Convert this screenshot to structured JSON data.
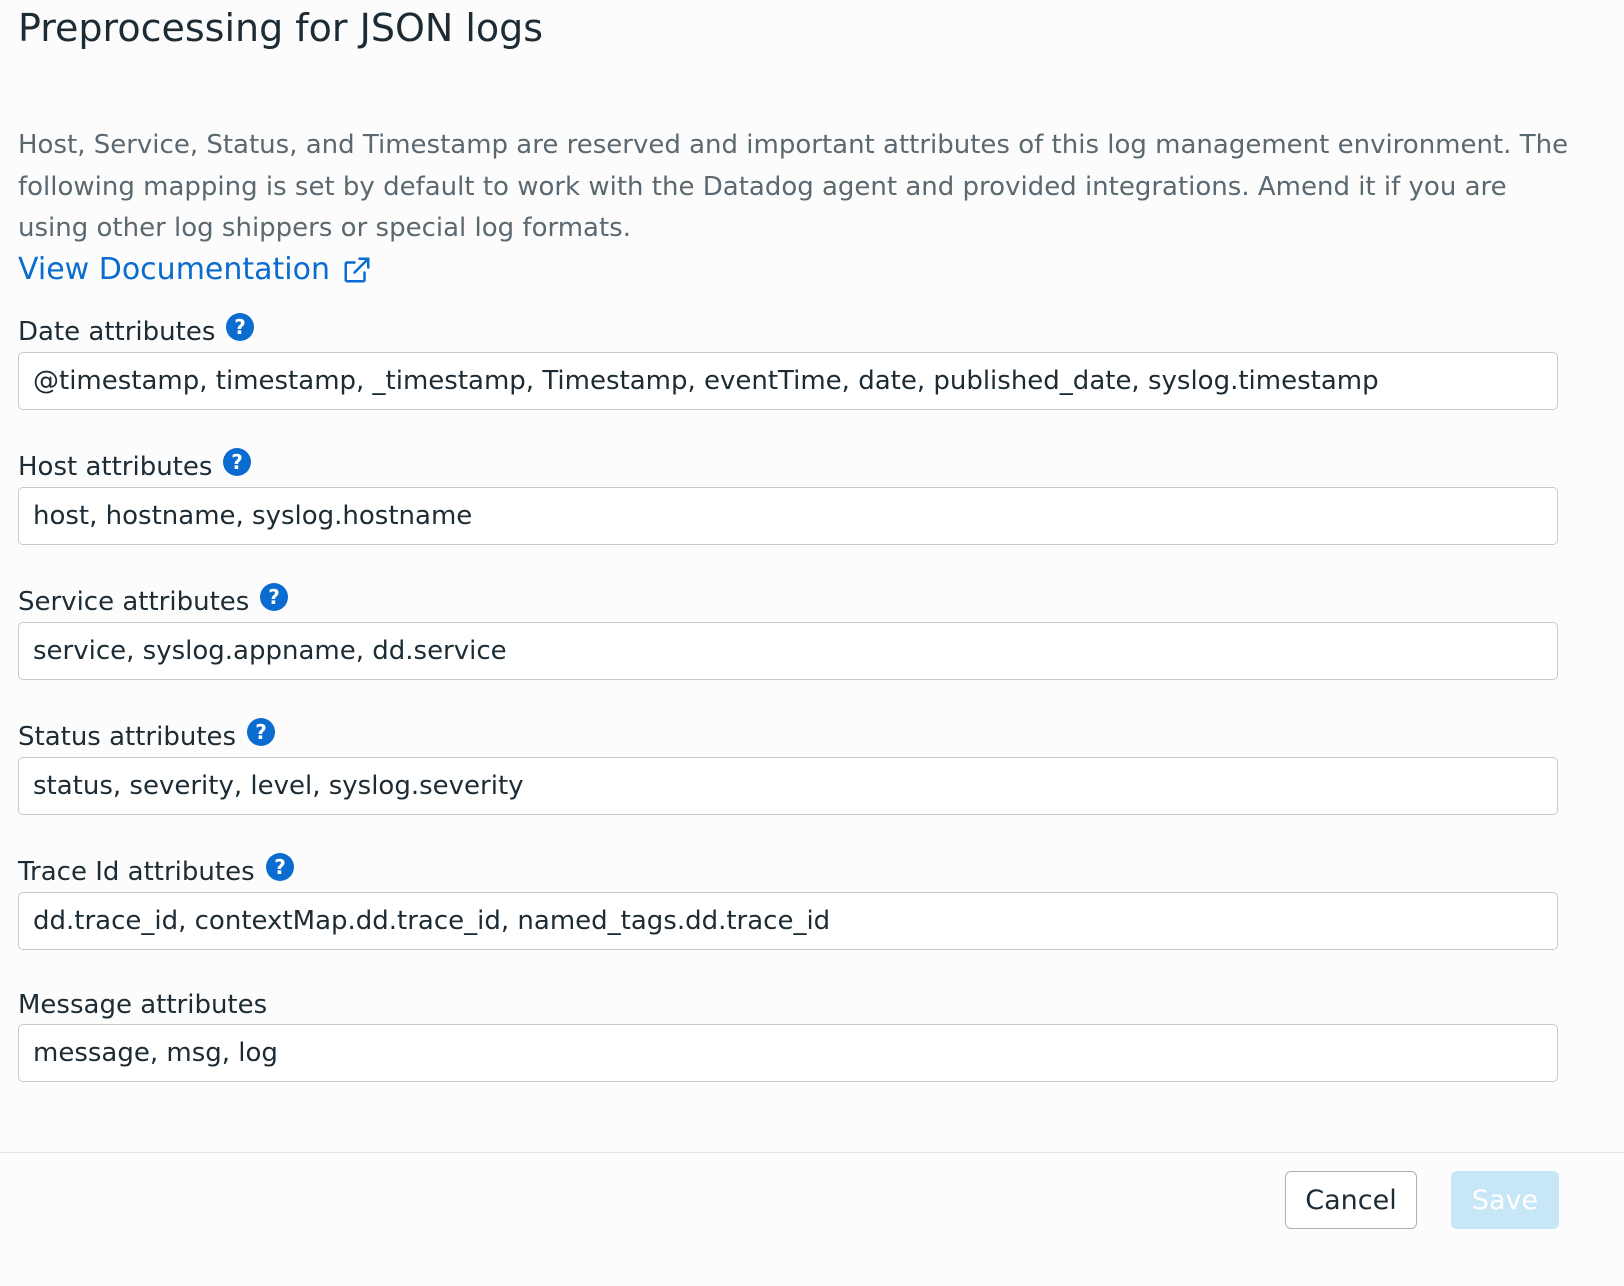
{
  "page": {
    "title": "Preprocessing for JSON logs",
    "description": "Host, Service, Status, and Timestamp are reserved and important attributes of this log management environment. The following mapping is set by default to work with the Datadog agent and provided integrations. Amend it if you are using other log shippers or special log formats.",
    "doc_link_label": "View Documentation"
  },
  "fields": {
    "date": {
      "label": "Date attributes",
      "value": "@timestamp, timestamp, _timestamp, Timestamp, eventTime, date, published_date, syslog.timestamp",
      "help_icon": "question-circle-icon"
    },
    "host": {
      "label": "Host attributes",
      "value": "host, hostname, syslog.hostname",
      "help_icon": "question-circle-icon"
    },
    "service": {
      "label": "Service attributes",
      "value": "service, syslog.appname, dd.service",
      "help_icon": "question-circle-icon"
    },
    "status": {
      "label": "Status attributes",
      "value": "status, severity, level, syslog.severity",
      "help_icon": "question-circle-icon"
    },
    "trace_id": {
      "label": "Trace Id attributes",
      "value": "dd.trace_id, contextMap.dd.trace_id, named_tags.dd.trace_id",
      "help_icon": "question-circle-icon"
    },
    "message": {
      "label": "Message attributes",
      "value": "message, msg, log"
    }
  },
  "footer": {
    "cancel_label": "Cancel",
    "save_label": "Save",
    "save_enabled": false
  },
  "colors": {
    "link": "#0a6ccf",
    "help_icon": "#0a6ccf",
    "save_disabled_bg": "#c7e6f6",
    "text": "#1c2b34",
    "muted_text": "#5b6870"
  }
}
